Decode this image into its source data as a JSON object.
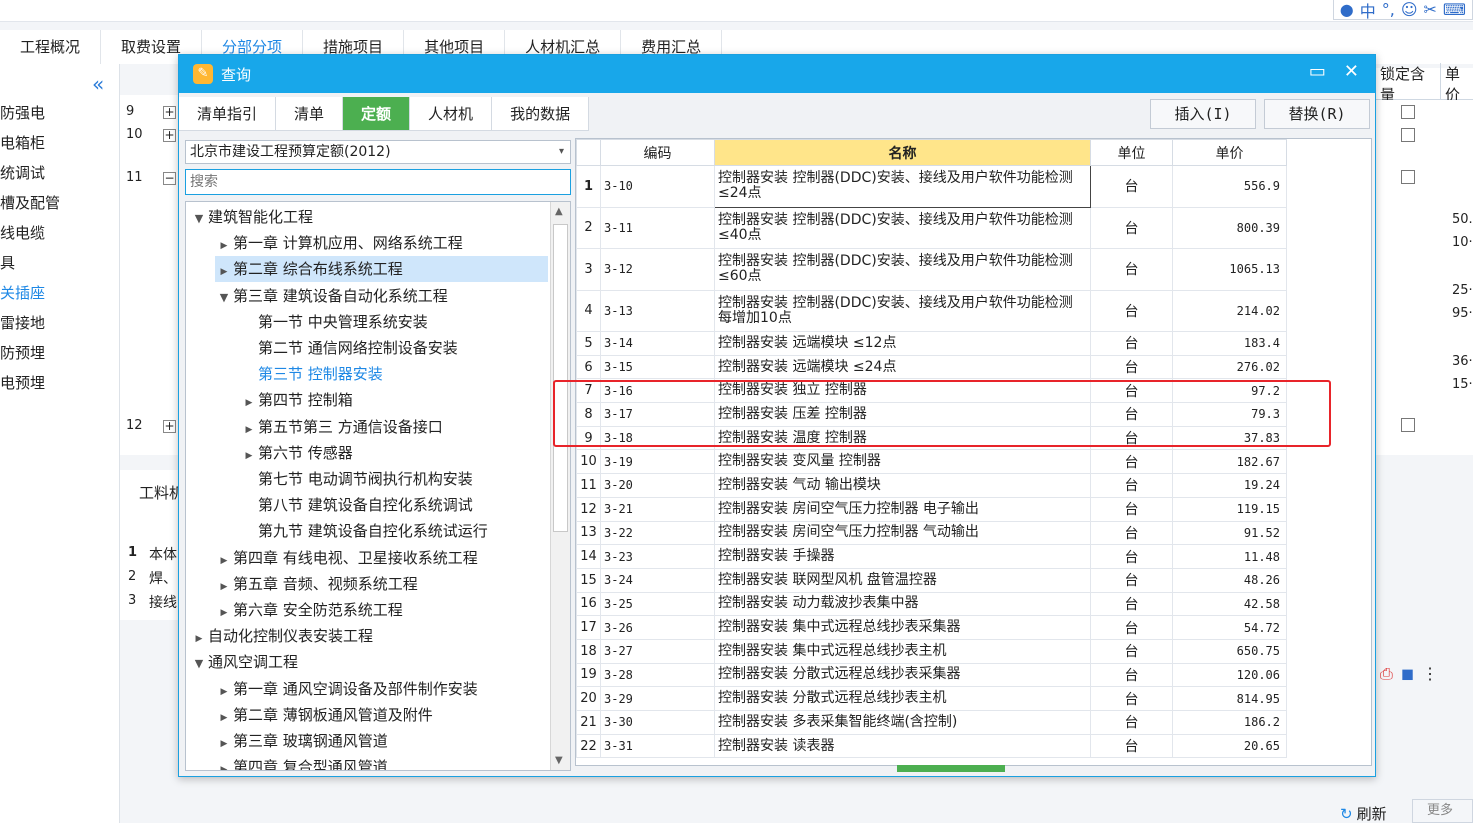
{
  "main_tabs": [
    {
      "label": "工程概况",
      "active": false
    },
    {
      "label": "取费设置",
      "active": false
    },
    {
      "label": "分部分项",
      "active": true
    },
    {
      "label": "措施项目",
      "active": false
    },
    {
      "label": "其他项目",
      "active": false
    },
    {
      "label": "人材机汇总",
      "active": false
    },
    {
      "label": "费用汇总",
      "active": false
    }
  ],
  "left_nav": [
    {
      "label": "防强电",
      "active": false
    },
    {
      "label": "电箱柜",
      "active": false
    },
    {
      "label": "统调试",
      "active": false
    },
    {
      "label": "槽及配管",
      "active": false
    },
    {
      "label": "线电缆",
      "active": false
    },
    {
      "label": "具",
      "active": false
    },
    {
      "label": "关插座",
      "active": true
    },
    {
      "label": "雷接地",
      "active": false
    },
    {
      "label": "防预埋",
      "active": false
    },
    {
      "label": "电预埋",
      "active": false
    }
  ],
  "bg_rows": [
    {
      "num": "9",
      "toggle": "+"
    },
    {
      "num": "10",
      "toggle": "+"
    },
    {
      "num": "11",
      "toggle": "−"
    },
    {
      "num": "12",
      "toggle": "+"
    }
  ],
  "bg_right": {
    "header1": "锁定含量",
    "header2": "单价",
    "values": [
      "50.",
      "10·",
      "25·",
      "95·",
      "36·",
      "15·"
    ]
  },
  "bg_bottom": {
    "tab_label": "工料机",
    "rows": [
      {
        "num": "1",
        "text": "本体"
      },
      {
        "num": "2",
        "text": "焊、"
      },
      {
        "num": "3",
        "text": "接线"
      }
    ]
  },
  "footer": {
    "refresh_label": "刷新",
    "more_label": "更多>>"
  },
  "dialog": {
    "title": "查询",
    "tabs": [
      {
        "label": "清单指引",
        "active": false
      },
      {
        "label": "清单",
        "active": false
      },
      {
        "label": "定额",
        "active": true
      },
      {
        "label": "人材机",
        "active": false
      },
      {
        "label": "我的数据",
        "active": false
      }
    ],
    "insert_label": "插入(I)",
    "replace_label": "替换(R)",
    "library": "北京市建设工程预算定额(2012)",
    "search_placeholder": "搜索",
    "tree": [
      {
        "label": "建筑智能化工程",
        "level": 0,
        "caret": "open",
        "selected": false,
        "active": false
      },
      {
        "label": "第一章 计算机应用、网络系统工程",
        "level": 1,
        "caret": "closed",
        "selected": false,
        "active": false
      },
      {
        "label": "第二章 综合布线系统工程",
        "level": 1,
        "caret": "closed",
        "selected": true,
        "active": false
      },
      {
        "label": "第三章 建筑设备自动化系统工程",
        "level": 1,
        "caret": "open",
        "selected": false,
        "active": false
      },
      {
        "label": "第一节 中央管理系统安装",
        "level": 2,
        "caret": "none",
        "selected": false,
        "active": false
      },
      {
        "label": "第二节 通信网络控制设备安装",
        "level": 2,
        "caret": "none",
        "selected": false,
        "active": false
      },
      {
        "label": "第三节 控制器安装",
        "level": 2,
        "caret": "none",
        "selected": false,
        "active": true
      },
      {
        "label": "第四节 控制箱",
        "level": 2,
        "caret": "closed",
        "selected": false,
        "active": false
      },
      {
        "label": "第五节第三 方通信设备接口",
        "level": 2,
        "caret": "closed",
        "selected": false,
        "active": false
      },
      {
        "label": "第六节 传感器",
        "level": 2,
        "caret": "closed",
        "selected": false,
        "active": false
      },
      {
        "label": "第七节 电动调节阀执行机构安装",
        "level": 2,
        "caret": "none",
        "selected": false,
        "active": false
      },
      {
        "label": "第八节 建筑设备自控化系统调试",
        "level": 2,
        "caret": "none",
        "selected": false,
        "active": false
      },
      {
        "label": "第九节 建筑设备自控化系统试运行",
        "level": 2,
        "caret": "none",
        "selected": false,
        "active": false
      },
      {
        "label": "第四章 有线电视、卫星接收系统工程",
        "level": 1,
        "caret": "closed",
        "selected": false,
        "active": false
      },
      {
        "label": "第五章 音频、视频系统工程",
        "level": 1,
        "caret": "closed",
        "selected": false,
        "active": false
      },
      {
        "label": "第六章 安全防范系统工程",
        "level": 1,
        "caret": "closed",
        "selected": false,
        "active": false
      },
      {
        "label": "自动化控制仪表安装工程",
        "level": 0,
        "caret": "closed",
        "selected": false,
        "active": false
      },
      {
        "label": "通风空调工程",
        "level": 0,
        "caret": "open",
        "selected": false,
        "active": false
      },
      {
        "label": "第一章 通风空调设备及部件制作安装",
        "level": 1,
        "caret": "closed",
        "selected": false,
        "active": false
      },
      {
        "label": "第二章 薄钢板通风管道及附件",
        "level": 1,
        "caret": "closed",
        "selected": false,
        "active": false
      },
      {
        "label": "第三章 玻璃钢通风管道",
        "level": 1,
        "caret": "closed",
        "selected": false,
        "active": false
      },
      {
        "label": "第四章 复合型通风管道",
        "level": 1,
        "caret": "closed",
        "selected": false,
        "active": false
      }
    ],
    "columns": {
      "code": "编码",
      "name": "名称",
      "unit": "单位",
      "price": "单价"
    },
    "rows": [
      {
        "n": "1",
        "code": "3-10",
        "name": "控制器安装 控制器(DDC)安装、接线及用户软件功能检测 ≤24点",
        "unit": "台",
        "price": "556.9",
        "tall": true
      },
      {
        "n": "2",
        "code": "3-11",
        "name": "控制器安装 控制器(DDC)安装、接线及用户软件功能检测 ≤40点",
        "unit": "台",
        "price": "800.39",
        "tall": true
      },
      {
        "n": "3",
        "code": "3-12",
        "name": "控制器安装 控制器(DDC)安装、接线及用户软件功能检测 ≤60点",
        "unit": "台",
        "price": "1065.13",
        "tall": true
      },
      {
        "n": "4",
        "code": "3-13",
        "name": "控制器安装 控制器(DDC)安装、接线及用户软件功能检测 每增加10点",
        "unit": "台",
        "price": "214.02",
        "tall": true
      },
      {
        "n": "5",
        "code": "3-14",
        "name": "控制器安装 远端模块 ≤12点",
        "unit": "台",
        "price": "183.4",
        "tall": false
      },
      {
        "n": "6",
        "code": "3-15",
        "name": "控制器安装 远端模块 ≤24点",
        "unit": "台",
        "price": "276.02",
        "tall": false
      },
      {
        "n": "7",
        "code": "3-16",
        "name": "控制器安装 独立 控制器",
        "unit": "台",
        "price": "97.2",
        "tall": false
      },
      {
        "n": "8",
        "code": "3-17",
        "name": "控制器安装 压差 控制器",
        "unit": "台",
        "price": "79.3",
        "tall": false
      },
      {
        "n": "9",
        "code": "3-18",
        "name": "控制器安装 温度 控制器",
        "unit": "台",
        "price": "37.83",
        "tall": false
      },
      {
        "n": "10",
        "code": "3-19",
        "name": "控制器安装 变风量 控制器",
        "unit": "台",
        "price": "182.67",
        "tall": false
      },
      {
        "n": "11",
        "code": "3-20",
        "name": "控制器安装 气动 输出模块",
        "unit": "台",
        "price": "19.24",
        "tall": false
      },
      {
        "n": "12",
        "code": "3-21",
        "name": "控制器安装 房间空气压力控制器 电子输出",
        "unit": "台",
        "price": "119.15",
        "tall": false
      },
      {
        "n": "13",
        "code": "3-22",
        "name": "控制器安装 房间空气压力控制器 气动输出",
        "unit": "台",
        "price": "91.52",
        "tall": false
      },
      {
        "n": "14",
        "code": "3-23",
        "name": "控制器安装 手操器",
        "unit": "台",
        "price": "11.48",
        "tall": false
      },
      {
        "n": "15",
        "code": "3-24",
        "name": "控制器安装 联网型风机 盘管温控器",
        "unit": "台",
        "price": "48.26",
        "tall": false
      },
      {
        "n": "16",
        "code": "3-25",
        "name": "控制器安装 动力载波抄表集中器",
        "unit": "台",
        "price": "42.58",
        "tall": false
      },
      {
        "n": "17",
        "code": "3-26",
        "name": "控制器安装 集中式远程总线抄表采集器",
        "unit": "台",
        "price": "54.72",
        "tall": false
      },
      {
        "n": "18",
        "code": "3-27",
        "name": "控制器安装 集中式远程总线抄表主机",
        "unit": "台",
        "price": "650.75",
        "tall": false
      },
      {
        "n": "19",
        "code": "3-28",
        "name": "控制器安装 分散式远程总线抄表采集器",
        "unit": "台",
        "price": "120.06",
        "tall": false
      },
      {
        "n": "20",
        "code": "3-29",
        "name": "控制器安装 分散式远程总线抄表主机",
        "unit": "台",
        "price": "814.95",
        "tall": false
      },
      {
        "n": "21",
        "code": "3-30",
        "name": "控制器安装 多表采集智能终端(含控制)",
        "unit": "台",
        "price": "186.2",
        "tall": false
      },
      {
        "n": "22",
        "code": "3-31",
        "name": "控制器安装 读表器",
        "unit": "台",
        "price": "20.65",
        "tall": false
      }
    ]
  },
  "colors": {
    "accent": "#1e88e5",
    "titlebar": "#18a7ea",
    "active_tab": "#4caf50",
    "highlight": "#e8242a"
  },
  "icons": [
    "ime-user-icon",
    "minimize-icon",
    "close-icon",
    "collapse-left-icon",
    "refresh-icon",
    "tree-caret-icon",
    "dropdown-arrow-icon"
  ]
}
